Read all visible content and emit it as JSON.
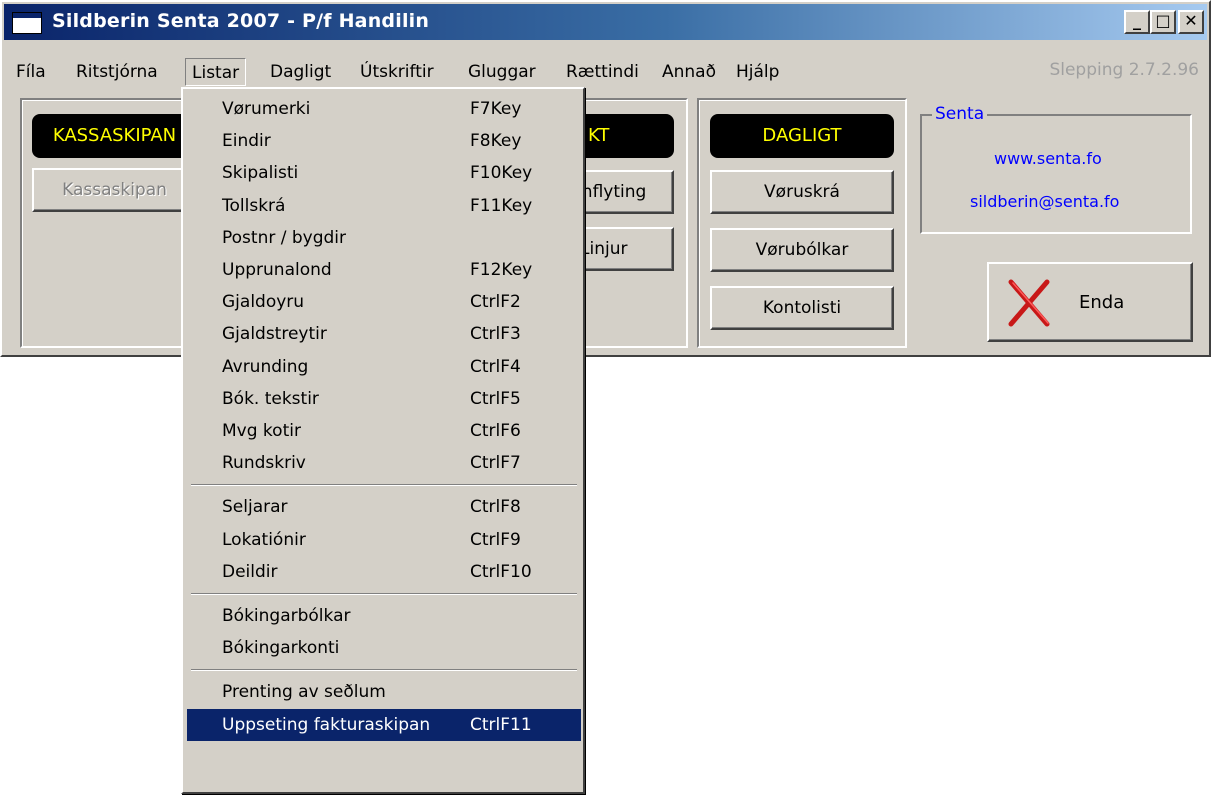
{
  "window": {
    "title": "Sildberin Senta 2007 - P/f Handilin",
    "minimize_glyph": "_",
    "maximize_glyph": "□",
    "close_glyph": "✕"
  },
  "menubar": {
    "items": [
      "Fíla",
      "Ritstjórna",
      "Listar",
      "Dagligt",
      "Útskriftir",
      "Gluggar",
      "Rættindi",
      "Annað",
      "Hjálp"
    ],
    "open_item": "Listar",
    "version": "Slepping 2.7.2.96"
  },
  "groups": {
    "kassaskipan": {
      "banner": "KASSASKIPAN",
      "button": "Kassaskipan"
    },
    "middle": {
      "banner": "KT",
      "buttons": [
        "Innflyting",
        "Linjur"
      ]
    },
    "dagligt": {
      "banner": "DAGLIGT",
      "buttons": [
        "Vøruskrá",
        "Vørubólkar",
        "Kontolisti"
      ]
    }
  },
  "senta": {
    "legend": "Senta",
    "website": "www.senta.fo",
    "email": "sildberin@senta.fo"
  },
  "enda": {
    "label": "Enda",
    "icon": "red-x-icon"
  },
  "dropdown": {
    "groups": [
      [
        {
          "label": "Vørumerki",
          "shortcut": "F7Key"
        },
        {
          "label": "Eindir",
          "shortcut": "F8Key"
        },
        {
          "label": "Skipalisti",
          "shortcut": "F10Key"
        },
        {
          "label": "Tollskrá",
          "shortcut": "F11Key"
        },
        {
          "label": "Postnr / bygdir",
          "shortcut": ""
        },
        {
          "label": "Upprunalond",
          "shortcut": "F12Key"
        },
        {
          "label": "Gjaldoyru",
          "shortcut": "CtrlF2"
        },
        {
          "label": "Gjaldstreytir",
          "shortcut": "CtrlF3"
        },
        {
          "label": "Avrunding",
          "shortcut": "CtrlF4"
        },
        {
          "label": "Bók. tekstir",
          "shortcut": "CtrlF5"
        },
        {
          "label": "Mvg kotir",
          "shortcut": "CtrlF6"
        },
        {
          "label": "Rundskriv",
          "shortcut": "CtrlF7"
        }
      ],
      [
        {
          "label": "Seljarar",
          "shortcut": "CtrlF8"
        },
        {
          "label": "Lokatiónir",
          "shortcut": "CtrlF9"
        },
        {
          "label": "Deildir",
          "shortcut": "CtrlF10"
        }
      ],
      [
        {
          "label": "Bókingarbólkar",
          "shortcut": ""
        },
        {
          "label": "Bókingarkonti",
          "shortcut": ""
        }
      ],
      [
        {
          "label": "Prenting av seðlum",
          "shortcut": ""
        },
        {
          "label": "Uppseting fakturaskipan",
          "shortcut": "CtrlF11",
          "selected": true
        }
      ]
    ]
  },
  "colors": {
    "title_start": "#0a246a",
    "title_end": "#a6caf0",
    "banner_text": "#ffff00",
    "link": "#0000ff",
    "selection": "#0a246a"
  }
}
